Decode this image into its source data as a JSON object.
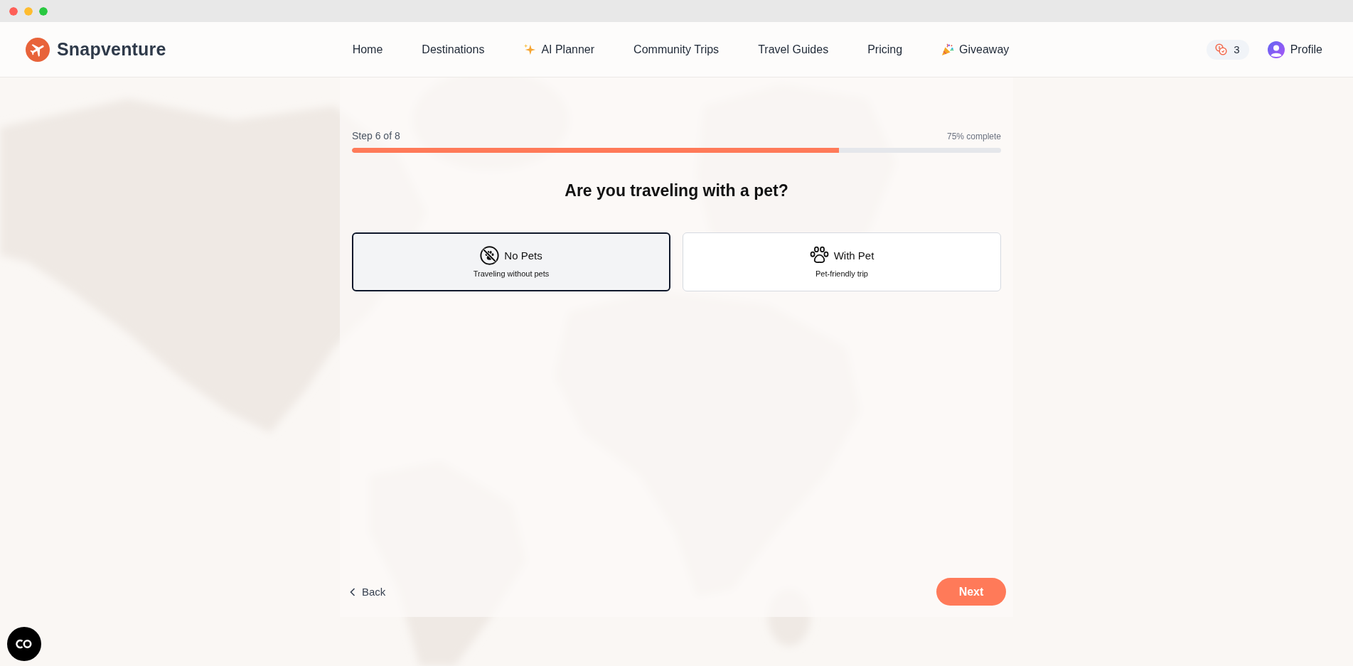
{
  "header": {
    "brand": "Snapventure",
    "nav": [
      {
        "kind": "link",
        "label": "Home"
      },
      {
        "kind": "link",
        "label": "Destinations"
      },
      {
        "kind": "ai",
        "label": "AI Planner"
      },
      {
        "kind": "link",
        "label": "Community Trips"
      },
      {
        "kind": "link",
        "label": "Travel Guides"
      },
      {
        "kind": "link",
        "label": "Pricing"
      },
      {
        "kind": "event",
        "label": "Giveaway"
      }
    ],
    "coins": "3",
    "profile": "Profile"
  },
  "progress": {
    "step_label": "Step 6 of 8",
    "percent_label": "75% complete",
    "level": 0.75
  },
  "question": "Are you traveling with a pet?",
  "options": [
    {
      "kind": "no-pets",
      "title": "No Pets",
      "subtitle": "Traveling without pets",
      "selected": true
    },
    {
      "kind": "with-pet",
      "title": "With Pet",
      "subtitle": "Pet-friendly trip",
      "selected": false
    }
  ],
  "footer": {
    "back": "Back",
    "next": "Next"
  }
}
